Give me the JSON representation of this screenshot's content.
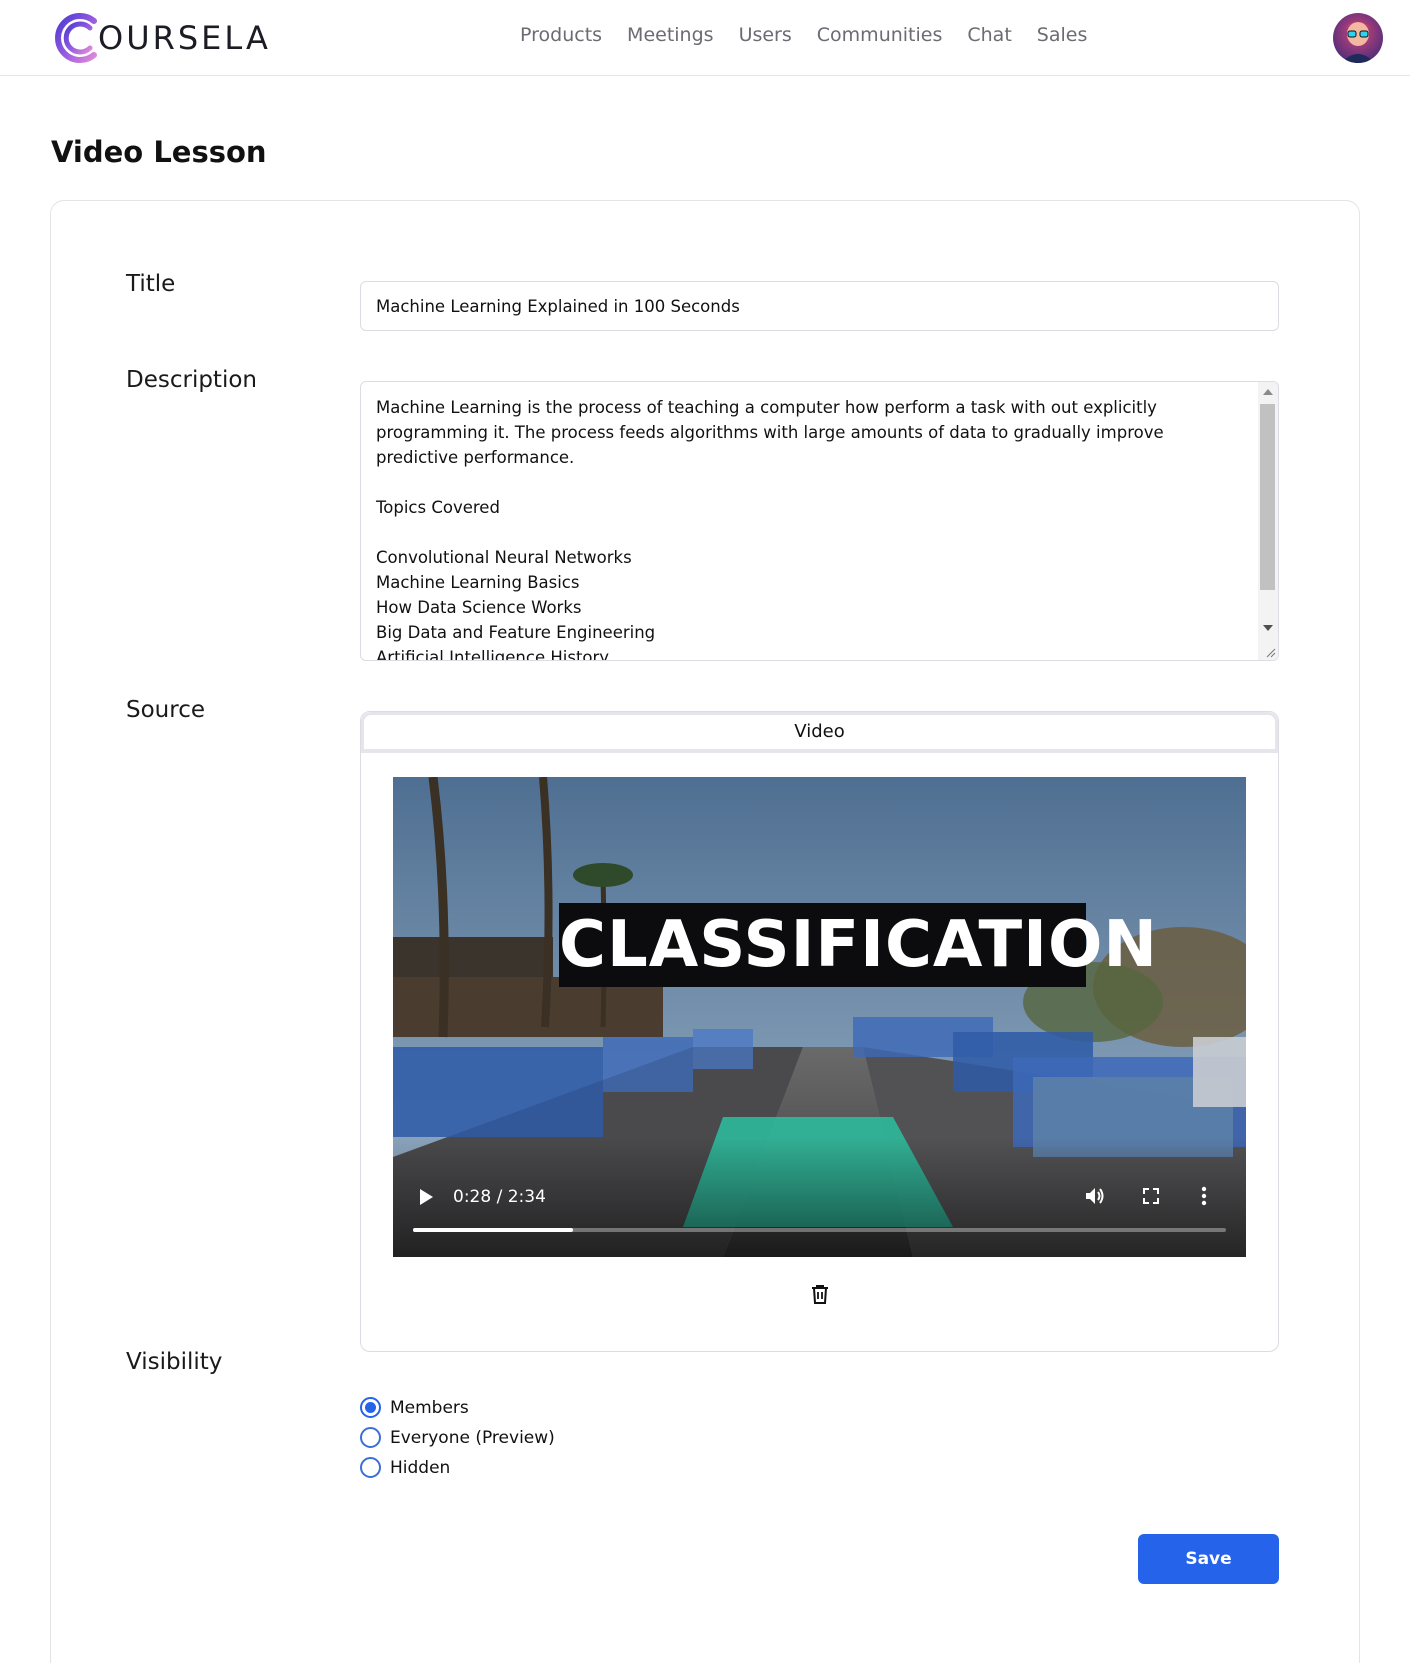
{
  "header": {
    "logo_text": "OURSELA",
    "nav": [
      "Products",
      "Meetings",
      "Users",
      "Communities",
      "Chat",
      "Sales"
    ]
  },
  "page": {
    "title": "Video Lesson"
  },
  "form": {
    "title_label": "Title",
    "title_value": "Machine Learning Explained in 100 Seconds",
    "description_label": "Description",
    "description_value": "Machine Learning is the process of teaching a computer how perform a task with out explicitly programming it. The process feeds algorithms with large amounts of data to gradually improve predictive performance.\n\nTopics Covered\n\nConvolutional Neural Networks\nMachine Learning Basics\nHow Data Science Works\nBig Data and Feature Engineering\nArtificial Intelligence History",
    "source_label": "Source",
    "source_tab": "Video",
    "video": {
      "caption": "CLASSIFICATION",
      "time": "0:28 / 2:34",
      "progress": 0.197
    },
    "visibility_label": "Visibility",
    "visibility_options": [
      {
        "label": "Members",
        "checked": true
      },
      {
        "label": "Everyone (Preview)",
        "checked": false
      },
      {
        "label": "Hidden",
        "checked": false
      }
    ],
    "save_label": "Save"
  },
  "colors": {
    "accent": "#2563eb",
    "logo_gradient_start": "#5b3fd1",
    "logo_gradient_end": "#c46adf"
  }
}
